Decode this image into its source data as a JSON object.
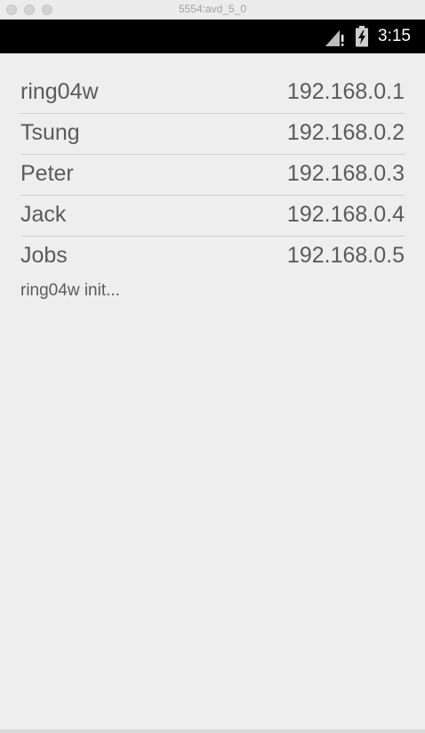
{
  "window": {
    "title": "5554:avd_5_0"
  },
  "status_bar": {
    "time": "3:15",
    "icons": [
      "signal-no-data-icon",
      "battery-charging-icon"
    ]
  },
  "hosts": [
    {
      "name": "ring04w",
      "ip": "192.168.0.1"
    },
    {
      "name": "Tsung",
      "ip": "192.168.0.2"
    },
    {
      "name": "Peter",
      "ip": "192.168.0.3"
    },
    {
      "name": "Jack",
      "ip": "192.168.0.4"
    },
    {
      "name": "Jobs",
      "ip": "192.168.0.5"
    }
  ],
  "status_message": "ring04w init..."
}
